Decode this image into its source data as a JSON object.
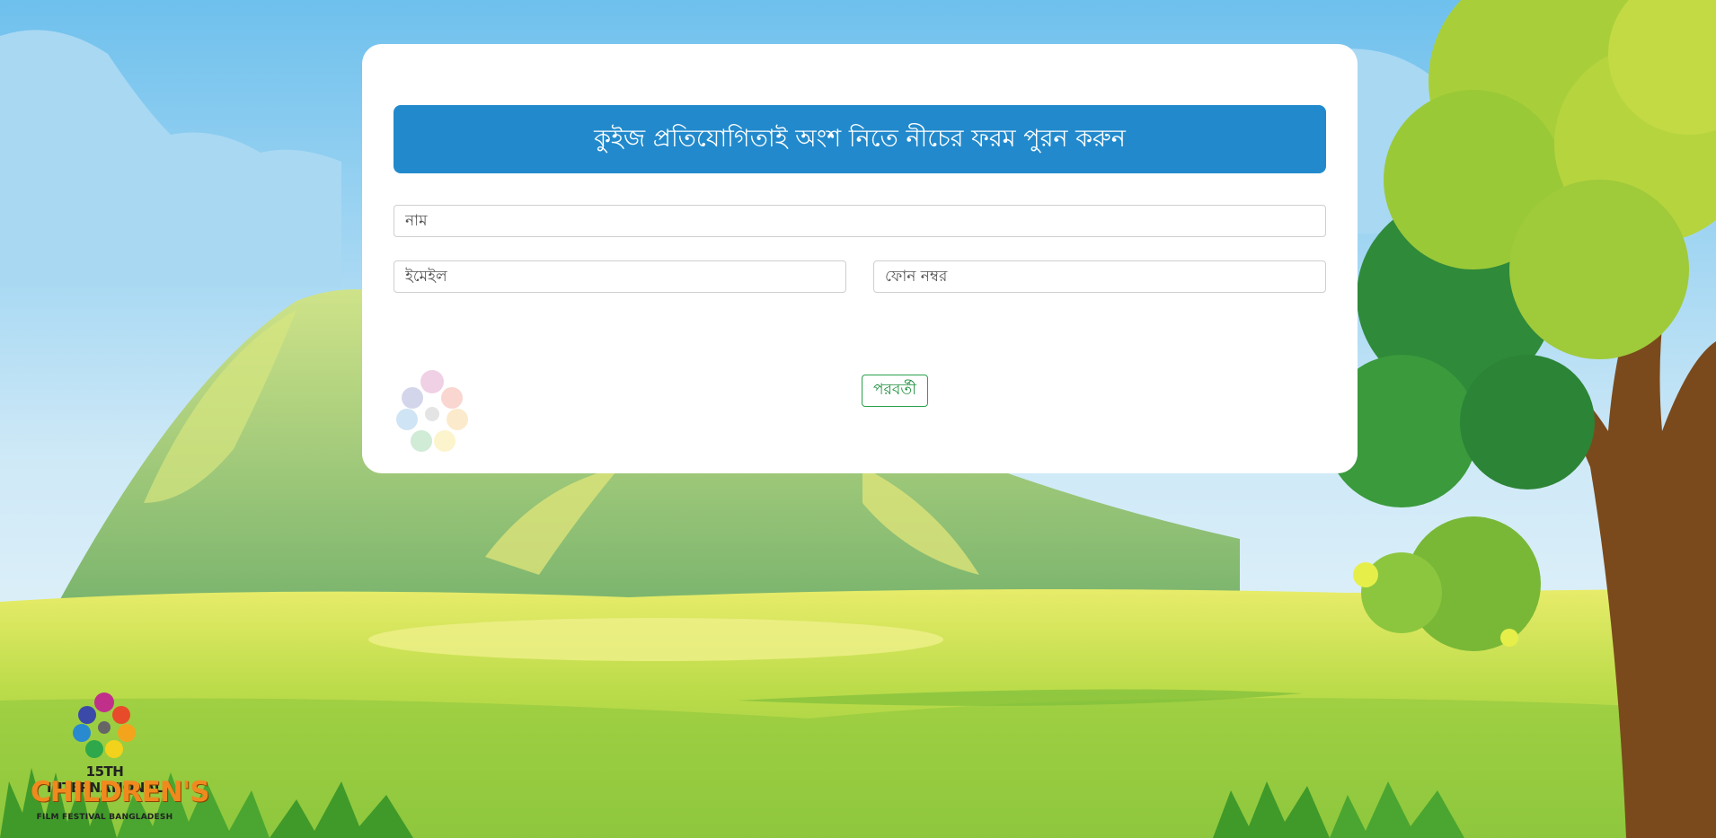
{
  "colors": {
    "banner": "#228acc",
    "next_button": "#1f8f3e",
    "sky": "#7cc4ee",
    "grass": "#a8d845"
  },
  "form": {
    "title": "কুইজ প্রতিযোগিতাই অংশ নিতে নীচের ফরম পুরন করুন",
    "name_placeholder": "নাম",
    "email_placeholder": "ইমেইল",
    "phone_placeholder": "ফোন নম্বর",
    "next_label": "পরবর্তী"
  },
  "logo": {
    "line1": "15TH INTERNATIONAL",
    "line2": "CHILDREN'S",
    "line3": "FILM FESTIVAL BANGLADESH"
  },
  "icons": {
    "watermark": "flower-logo-icon",
    "logo": "festival-logo-icon"
  }
}
